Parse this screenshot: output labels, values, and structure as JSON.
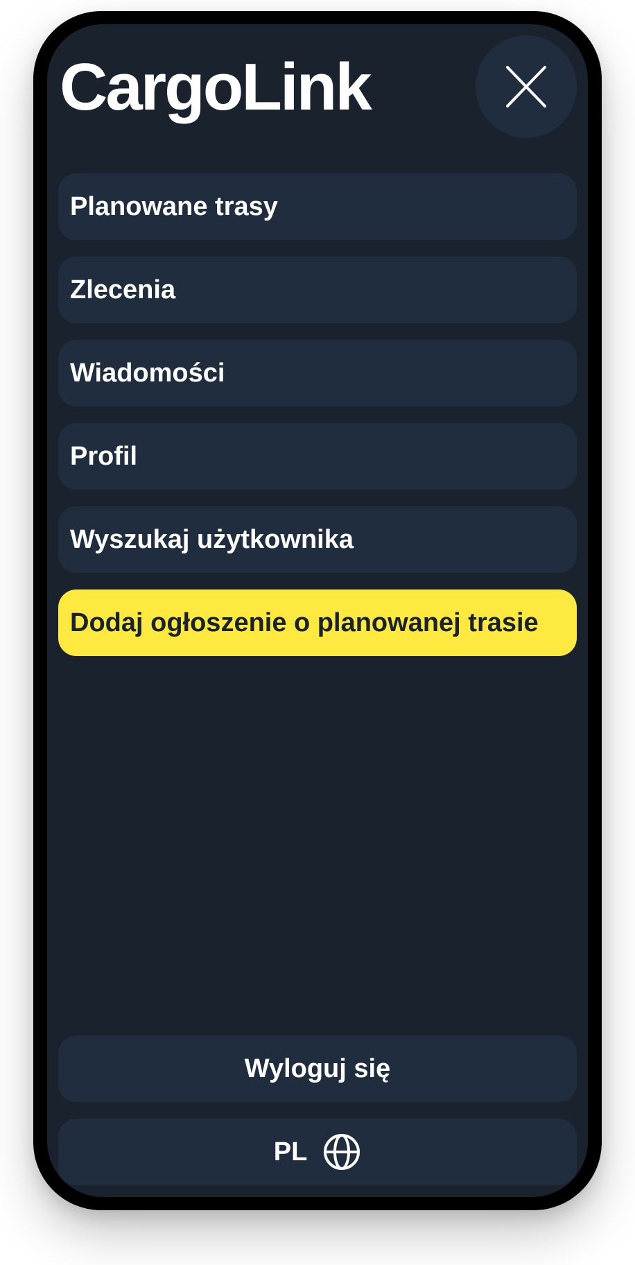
{
  "app": {
    "title": "CargoLink"
  },
  "header": {
    "close_icon": "close-icon"
  },
  "menu": {
    "items": [
      {
        "label": "Planowane trasy"
      },
      {
        "label": "Zlecenia"
      },
      {
        "label": "Wiadomości"
      },
      {
        "label": "Profil"
      },
      {
        "label": "Wyszukaj użytkownika"
      },
      {
        "label": "Dodaj ogłoszenie o planowanej trasie"
      }
    ]
  },
  "footer": {
    "logout_label": "Wyloguj się",
    "language_code": "PL",
    "language_icon": "globe-icon"
  },
  "colors": {
    "background": "#1a222d",
    "surface": "#1f2d3e",
    "accent": "#fde93f",
    "text": "#ffffff",
    "frame": "#000000"
  }
}
